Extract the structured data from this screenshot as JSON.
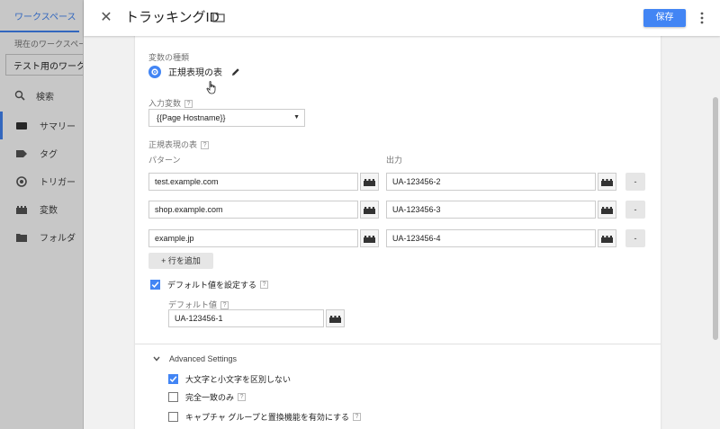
{
  "sidebar": {
    "workspace_tab": "ワークスペース",
    "current_workspace_label": "現在のワークスペース",
    "current_workspace": "テスト用のワークスペース",
    "search": "検索",
    "items": [
      {
        "label": "サマリー",
        "icon": "summary-icon",
        "active": true
      },
      {
        "label": "タグ",
        "icon": "tag-icon",
        "active": false
      },
      {
        "label": "トリガー",
        "icon": "trigger-icon",
        "active": false
      },
      {
        "label": "変数",
        "icon": "variable-icon",
        "active": false
      },
      {
        "label": "フォルダ",
        "icon": "folder-icon",
        "active": false
      }
    ]
  },
  "header": {
    "title": "トラッキングID",
    "save_label": "保存"
  },
  "form": {
    "variable_type_label": "変数の種類",
    "variable_type_name": "正規表現の表",
    "input_variable_label": "入力変数",
    "input_variable_value": "{{Page Hostname}}",
    "regex_table_label": "正規表現の表",
    "pattern_header": "パターン",
    "output_header": "出力",
    "rows": [
      {
        "pattern": "test.example.com",
        "output": "UA-123456-2",
        "remove": "-"
      },
      {
        "pattern": "shop.example.com",
        "output": "UA-123456-3",
        "remove": "-"
      },
      {
        "pattern": "example.jp",
        "output": "UA-123456-4",
        "remove": "-"
      }
    ],
    "add_row_label": "+ 行を追加",
    "set_default_label": "デフォルト値を設定する",
    "default_value_label": "デフォルト値",
    "default_value": "UA-123456-1",
    "advanced_label": "Advanced Settings",
    "ignore_case_label": "大文字と小文字を区別しない",
    "full_match_label": "完全一致のみ",
    "capture_groups_label": "キャプチャ グループと置換機能を有効にする",
    "help_glyph": "?"
  },
  "colors": {
    "accent": "#4285f4"
  }
}
